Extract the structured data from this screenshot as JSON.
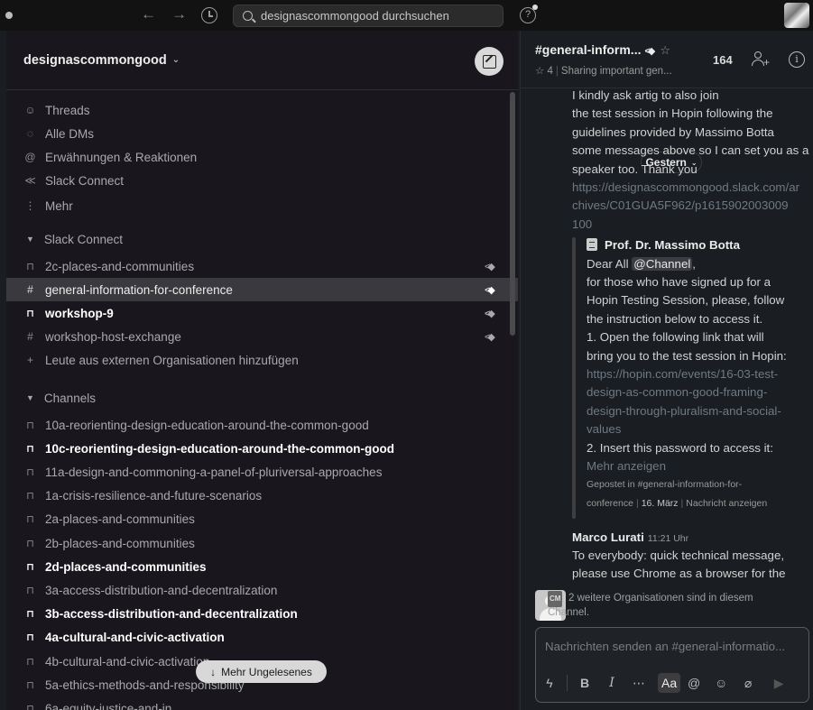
{
  "topbar": {
    "back_arrow": "←",
    "forward_arrow": "→",
    "search_placeholder": "designascommongood durchsuchen",
    "help_symbol": "?"
  },
  "sidebar": {
    "workspace": "designascommongood",
    "nav": [
      {
        "icon": "threads-icon",
        "glyph": "☺",
        "label": "Threads"
      },
      {
        "icon": "dms-icon",
        "glyph": "◌",
        "label": "Alle DMs"
      },
      {
        "icon": "mentions-icon",
        "glyph": "@",
        "label": "Erwähnungen & Reaktionen"
      },
      {
        "icon": "slack-connect-icon",
        "glyph": "≪",
        "label": "Slack Connect"
      },
      {
        "icon": "more-icon",
        "glyph": "⋮",
        "label": "Mehr"
      }
    ],
    "slack_connect_section": "Slack Connect",
    "slack_connect_channels": [
      {
        "name": "2c-places-and-communities",
        "icon": "lock-icon",
        "bold": false,
        "active": false,
        "shared": true
      },
      {
        "name": "general-information-for-conference",
        "icon": "hash-icon",
        "bold": false,
        "active": true,
        "shared": true
      },
      {
        "name": "workshop-9",
        "icon": "lock-icon",
        "bold": true,
        "active": false,
        "shared": true
      },
      {
        "name": "workshop-host-exchange",
        "icon": "hash-icon",
        "bold": false,
        "active": false,
        "shared": true
      }
    ],
    "add_external": "Leute aus externen Organisationen hinzufügen",
    "channels_section": "Channels",
    "channels": [
      {
        "name": "10a-reorienting-design-education-around-the-common-good",
        "bold": false
      },
      {
        "name": "10c-reorienting-design-education-around-the-common-good",
        "bold": true
      },
      {
        "name": "11a-design-and-commoning-a-panel-of-pluriversal-approaches",
        "bold": false
      },
      {
        "name": "1a-crisis-resilience-and-future-scenarios",
        "bold": false
      },
      {
        "name": "2a-places-and-communities",
        "bold": false
      },
      {
        "name": "2b-places-and-communities",
        "bold": false
      },
      {
        "name": "2d-places-and-communities",
        "bold": true
      },
      {
        "name": "3a-access-distribution-and-decentralization",
        "bold": false
      },
      {
        "name": "3b-access-distribution-and-decentralization",
        "bold": true
      },
      {
        "name": "4a-cultural-and-civic-activation",
        "bold": true
      },
      {
        "name": "4b-cultural-and-civic-activation",
        "bold": false
      },
      {
        "name": "5a-ethics-methods-and-responsibility",
        "bold": false
      },
      {
        "name": "6a-equity-justice-and-in",
        "bold": false
      }
    ],
    "more_unread": "Mehr Ungelesenes",
    "more_unread_arrow": "↓"
  },
  "channel": {
    "title": "#general-inform...",
    "members_pinned": "4",
    "topic": "Sharing important gen...",
    "member_count": "164"
  },
  "messages": {
    "date_divider": "Gestern",
    "lines": [
      "I kindly ask                       artig  to also join",
      "the test session in Hopin following the",
      "guidelines provided by Massimo Botta",
      "some messages above so I can set you as a",
      "speaker too. Thank you"
    ],
    "link_lines": [
      "https://designascommongood.slack.com/ar",
      "chives/C01GUA5F962/p1615902003009",
      "100"
    ],
    "quote": {
      "author": "Prof. Dr. Massimo Botta",
      "greeting": "Dear All ",
      "mention": "@Channel",
      "greeting_end": ",",
      "lines": [
        "for those who have signed up for a",
        "Hopin Testing Session, please, follow",
        "the instruction below to access it.",
        "1. Open the following link that will",
        "bring you to the test session in Hopin:"
      ],
      "link_lines": [
        "https://hopin.com/events/16-03-test-",
        "design-as-common-good-framing-",
        "design-through-pluralism-and-social-",
        "values"
      ],
      "step2": "2. Insert this password to access it:",
      "show_more": "Mehr anzeigen",
      "posted_in_1": "Gepostet in #general-information-for-",
      "posted_in_2": "conference",
      "date": "16. März",
      "view_message": "Nachricht anzeigen"
    },
    "next_author": "Marco Lurati",
    "next_time": "11:21 Uhr",
    "next_lines": [
      "To everybody: quick technical message,",
      "please use Chrome as a browser for the"
    ],
    "org_badge": "CM",
    "org_note_bold": "2 weitere Organisationen",
    "org_note_rest": " sind in diesem Channel."
  },
  "composer": {
    "placeholder": "Nachrichten senden an #general-informatio...",
    "bold": "B",
    "italic": "I",
    "more": "⋯",
    "format": "Aa",
    "at": "@",
    "emoji": "☺",
    "attach": "⌀",
    "send": "▶",
    "shortcut": "ϟ"
  }
}
